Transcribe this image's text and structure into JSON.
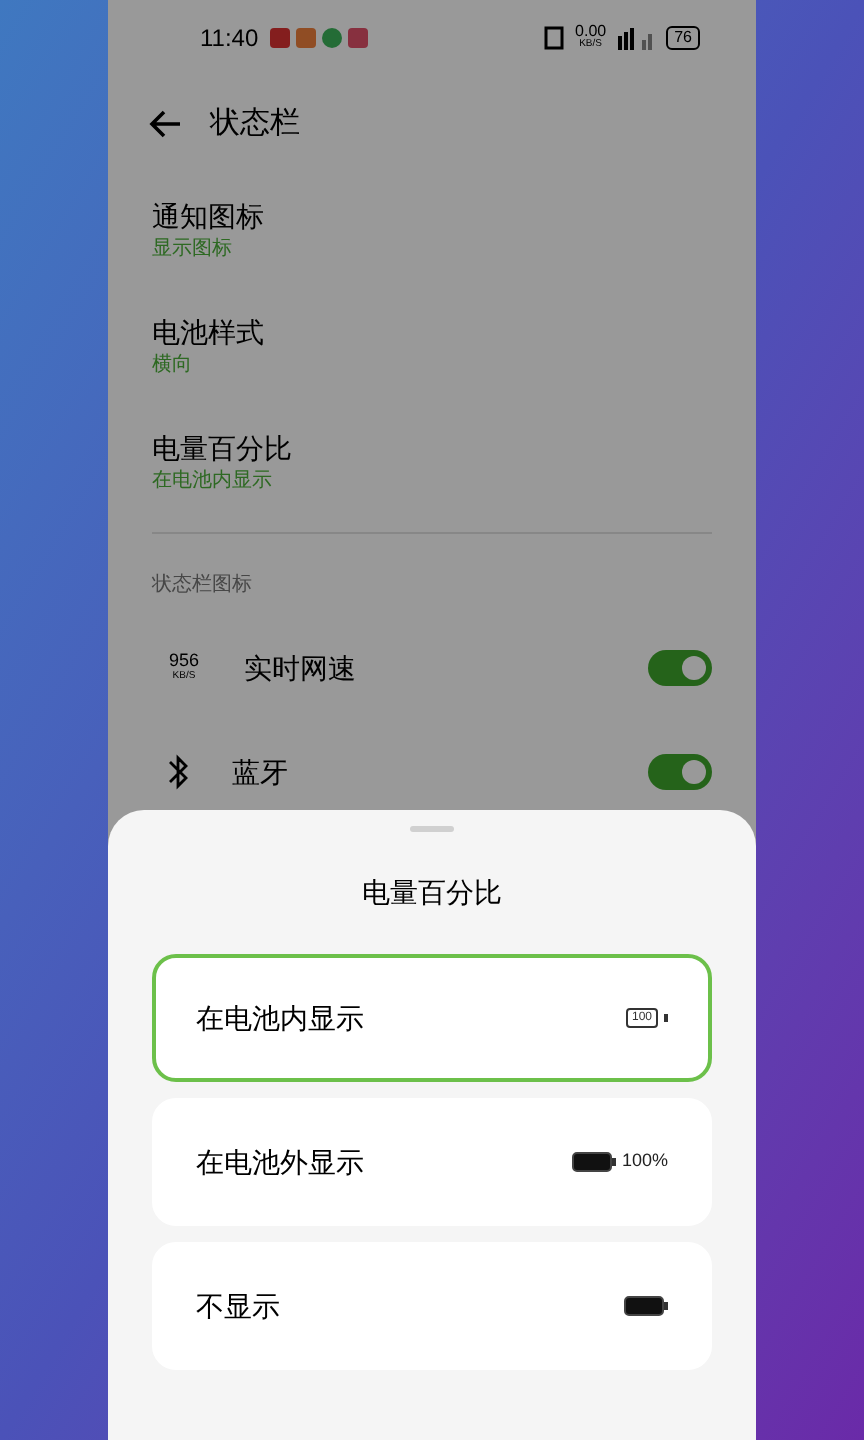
{
  "status_bar": {
    "time": "11:40",
    "net_speed": "0.00",
    "net_unit": "KB/S",
    "battery": "76"
  },
  "header": {
    "title": "状态栏"
  },
  "settings": [
    {
      "label": "通知图标",
      "value": "显示图标"
    },
    {
      "label": "电池样式",
      "value": "横向"
    },
    {
      "label": "电量百分比",
      "value": "在电池内显示"
    }
  ],
  "section": {
    "title": "状态栏图标"
  },
  "icon_rows": [
    {
      "kind": "speed",
      "icon_value": "956",
      "icon_unit": "KB/S",
      "label": "实时网速",
      "on": true
    },
    {
      "kind": "bluetooth",
      "label": "蓝牙",
      "on": true
    }
  ],
  "sheet": {
    "title": "电量百分比",
    "options": [
      {
        "kind": "inside",
        "label": "在电池内显示",
        "battery_text": "100",
        "selected": true
      },
      {
        "kind": "outside",
        "label": "在电池外显示",
        "battery_text": "100%",
        "selected": false
      },
      {
        "kind": "none",
        "label": "不显示",
        "selected": false
      }
    ]
  }
}
